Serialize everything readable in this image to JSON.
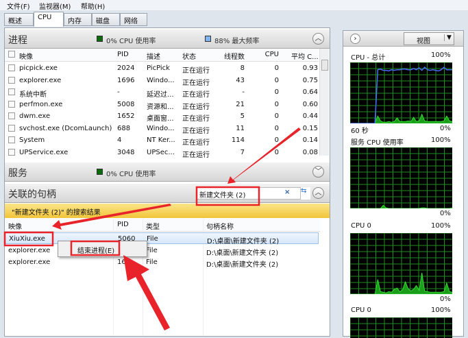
{
  "menu": [
    "文件(F)",
    "监视器(M)",
    "帮助(H)"
  ],
  "tabs": [
    "概述",
    "CPU",
    "内存",
    "磁盘",
    "网络"
  ],
  "active_tab": "CPU",
  "processes": {
    "title": "进程",
    "cpu_usage": "0% CPU 使用率",
    "max_freq": "88% 最大频率",
    "columns": [
      "映像",
      "PID",
      "描述",
      "状态",
      "线程数",
      "CPU",
      "平均 C..."
    ],
    "rows": [
      [
        "picpick.exe",
        "2024",
        "PicPick",
        "正在运行",
        "8",
        "0",
        "0.93"
      ],
      [
        "explorer.exe",
        "1696",
        "Windo...",
        "正在运行",
        "43",
        "0",
        "0.75"
      ],
      [
        "系统中断",
        "-",
        "延迟过...",
        "正在运行",
        "-",
        "0",
        "0.64"
      ],
      [
        "perfmon.exe",
        "5008",
        "资源和...",
        "正在运行",
        "21",
        "0",
        "0.60"
      ],
      [
        "dwm.exe",
        "1652",
        "桌面窗...",
        "正在运行",
        "5",
        "0",
        "0.44"
      ],
      [
        "svchost.exe (DcomLaunch)",
        "688",
        "Windo...",
        "正在运行",
        "11",
        "0",
        "0.15"
      ],
      [
        "System",
        "4",
        "NT Ker...",
        "正在运行",
        "114",
        "0",
        "0.14"
      ],
      [
        "UPService.exe",
        "3048",
        "UPSec...",
        "正在运行",
        "7",
        "0",
        "0.08"
      ]
    ]
  },
  "services": {
    "title": "服务",
    "cpu_usage": "0% CPU 使用率"
  },
  "handles": {
    "title": "关联的句柄",
    "search_value": "新建文件夹 (2)",
    "result_banner": "\"新建文件夹 (2)\" 的搜索结果",
    "columns": [
      "映像",
      "PID",
      "类型",
      "句柄名称"
    ],
    "rows": [
      [
        "XiuXiu.exe",
        "5060",
        "File",
        "D:\\桌面\\新建文件夹 (2)"
      ],
      [
        "explorer.exe",
        "",
        "File",
        "D:\\桌面\\新建文件夹 (2)"
      ],
      [
        "explorer.exe",
        "16",
        "File",
        "D:\\桌面\\新建文件夹 (2)"
      ]
    ]
  },
  "context_menu": {
    "end_process": "结束进程(E)"
  },
  "right": {
    "view_label": "视图",
    "graphs": [
      {
        "title": "CPU - 总计",
        "max": "100%",
        "min": "0%",
        "time": "60 秒",
        "cpu": [
          0,
          0,
          0,
          0,
          0,
          0,
          0,
          0,
          0,
          0,
          12,
          4,
          2,
          2,
          3,
          2,
          3,
          9,
          3,
          3,
          3,
          4,
          3,
          10,
          3,
          4,
          15,
          4,
          3,
          3,
          3,
          3,
          3,
          3,
          4,
          12,
          4,
          3
        ],
        "freq": [
          0,
          0,
          0,
          0,
          0,
          0,
          0,
          0,
          0,
          0,
          88,
          89,
          87,
          87,
          86,
          88,
          87,
          88,
          88,
          89,
          89,
          88,
          88,
          90,
          88,
          91,
          87,
          92,
          88,
          87,
          88,
          87,
          86,
          88,
          92,
          88,
          88,
          88
        ]
      },
      {
        "title": "服务 CPU 使用率",
        "max": "100%",
        "min": "0%",
        "cpu": [
          0,
          0,
          0,
          0,
          0,
          0,
          0,
          0,
          0,
          0,
          0,
          0,
          5,
          1,
          0,
          0,
          0,
          0,
          0,
          0,
          0,
          0,
          0,
          0,
          0,
          0,
          1,
          1,
          0,
          0,
          0,
          0,
          0,
          0,
          0,
          0,
          0,
          1
        ]
      },
      {
        "title": "CPU 0",
        "max": "100%",
        "min": "0%",
        "cpu": [
          0,
          0,
          0,
          0,
          0,
          0,
          0,
          0,
          0,
          0,
          24,
          4,
          3,
          2,
          4,
          3,
          8,
          10,
          4,
          7,
          20,
          9,
          5,
          8,
          14,
          6,
          35,
          5,
          4,
          3,
          3,
          3,
          3,
          3,
          4,
          18,
          4,
          3
        ]
      },
      {
        "title": "CPU 0",
        "max": "100%",
        "cpu": [
          100,
          100,
          100,
          100,
          100,
          100,
          100,
          100,
          100,
          100,
          100,
          100,
          100,
          100,
          100,
          100,
          100,
          100,
          100,
          100,
          100,
          100,
          100,
          100,
          100,
          100,
          100,
          100,
          100,
          100,
          100,
          100,
          100,
          100,
          100,
          100,
          100,
          100
        ]
      }
    ]
  },
  "colors": {
    "grid": "#1f8f1f",
    "cpu_line": "#33dd33",
    "freq_line": "#4a6cff",
    "annotation": "#e8242a",
    "banner": "#f7d357"
  }
}
